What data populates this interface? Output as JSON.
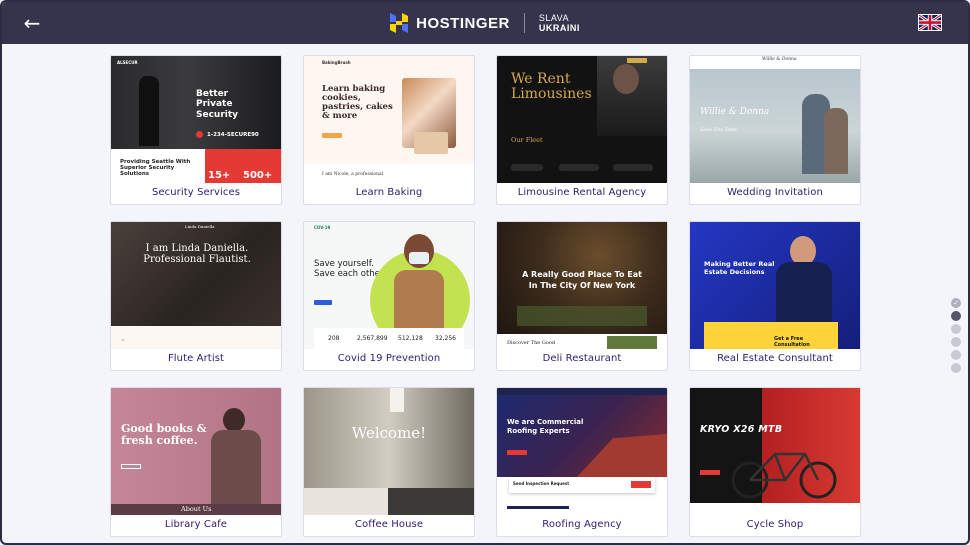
{
  "header": {
    "brand": "HOSTINGER",
    "slogan_line1": "SLAVA",
    "slogan_line2": "UKRAINI",
    "back_glyph": "←",
    "back_icon": "arrow-left-icon",
    "language_icon": "uk-flag-icon"
  },
  "templates": [
    {
      "label": "Security Services",
      "thumb": {
        "nav": "ALSECUR",
        "headline": "Better Private Security",
        "phone": "1-234-SECURE90",
        "tagline": "Providing Seattle With Superior Security Solutions",
        "stat1": "15+",
        "stat2": "500+"
      }
    },
    {
      "label": "Learn Baking",
      "thumb": {
        "nav": "BakingBrush",
        "headline": "Learn baking cookies, pastries, cakes & more",
        "footer": "I am Nicole, a professional"
      }
    },
    {
      "label": "Limousine Rental Agency",
      "thumb": {
        "headline": "We Rent Limousines",
        "section": "Our Fleet"
      }
    },
    {
      "label": "Wedding Invitation",
      "thumb": {
        "nav": "Willie & Donna",
        "headline": "Willie & Donna",
        "sub": "Save The Date"
      }
    },
    {
      "label": "Flute Artist",
      "thumb": {
        "nav": "Linda Daniella",
        "headline": "I am Linda Daniella. Professional Flautist."
      }
    },
    {
      "label": "Covid 19 Prevention",
      "thumb": {
        "nav": "COV-19",
        "headline": "Save yourself. Save each other.",
        "stats": [
          "208",
          "2,567,899",
          "512,128",
          "32,256"
        ]
      }
    },
    {
      "label": "Deli Restaurant",
      "thumb": {
        "headline": "A Really Good Place To Eat In The City Of New York",
        "footer": "Discover The Good"
      }
    },
    {
      "label": "Real Estate Consultant",
      "thumb": {
        "headline": "Making Better Real Estate Decisions",
        "cta": "Get a Free Consultation"
      }
    },
    {
      "label": "Library Cafe",
      "thumb": {
        "headline": "Good books & fresh coffee.",
        "footer": "About Us"
      }
    },
    {
      "label": "Coffee House",
      "thumb": {
        "headline": "Welcome!"
      }
    },
    {
      "label": "Roofing Agency",
      "thumb": {
        "headline": "We are Commercial Roofing Experts",
        "form": "Send Inspection Request"
      }
    },
    {
      "label": "Cycle Shop",
      "thumb": {
        "headline": "KRYO X26 MTB"
      }
    }
  ],
  "pager": {
    "done_glyph": "✓",
    "count": 6,
    "active_index": 1
  },
  "colors": {
    "topbar": "#36344d",
    "label": "#2f1c6a",
    "background": "#f4f4fb",
    "accent_red": "#e53935"
  }
}
